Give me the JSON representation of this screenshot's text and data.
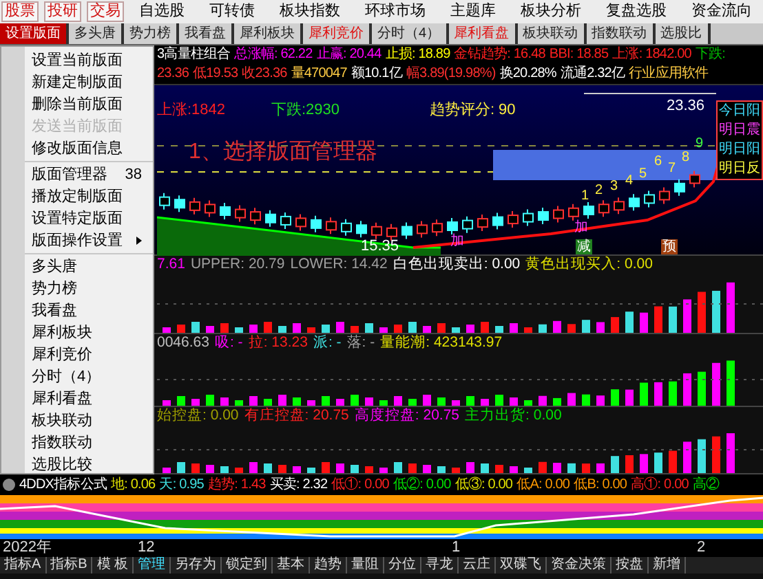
{
  "toolbar": [
    {
      "label": "股票",
      "kind": "boxed"
    },
    {
      "label": "投研",
      "kind": "boxed"
    },
    {
      "label": "交易",
      "kind": "boxed"
    },
    {
      "label": "自选股",
      "kind": "plain"
    },
    {
      "label": "可转债",
      "kind": "plain"
    },
    {
      "label": "板块指数",
      "kind": "plain"
    },
    {
      "label": "环球市场",
      "kind": "plain"
    },
    {
      "label": "主题库",
      "kind": "plain"
    },
    {
      "label": "板块分析",
      "kind": "plain"
    },
    {
      "label": "复盘选股",
      "kind": "plain"
    },
    {
      "label": "资金流向",
      "kind": "plain"
    }
  ],
  "tabs": [
    {
      "label": "设置版面",
      "selected": true,
      "highlighted": false
    },
    {
      "label": "多头唐",
      "selected": false,
      "highlighted": false
    },
    {
      "label": "势力榜",
      "selected": false,
      "highlighted": false
    },
    {
      "label": "我看盘",
      "selected": false,
      "highlighted": false
    },
    {
      "label": "犀利板块",
      "selected": false,
      "highlighted": false
    },
    {
      "label": "犀利竞价",
      "selected": false,
      "highlighted": true
    },
    {
      "label": "分时（4）",
      "selected": false,
      "highlighted": false
    },
    {
      "label": "犀利看盘",
      "selected": false,
      "highlighted": true
    },
    {
      "label": "板块联动",
      "selected": false,
      "highlighted": false
    },
    {
      "label": "指数联动",
      "selected": false,
      "highlighted": false
    },
    {
      "label": "选股比",
      "selected": false,
      "highlighted": false
    }
  ],
  "context_menu": {
    "groups": [
      [
        {
          "label": "设置当前版面",
          "disabled": false,
          "has_submenu": false
        },
        {
          "label": "新建定制版面",
          "disabled": false,
          "has_submenu": false
        },
        {
          "label": "删除当前版面",
          "disabled": false,
          "has_submenu": false
        },
        {
          "label": "发送当前版面",
          "disabled": true,
          "has_submenu": false
        },
        {
          "label": "修改版面信息",
          "disabled": false,
          "has_submenu": false
        }
      ],
      [
        {
          "label": "版面管理器",
          "shortcut": "38",
          "disabled": false,
          "has_submenu": false
        },
        {
          "label": "播放定制版面",
          "disabled": false,
          "has_submenu": false
        },
        {
          "label": "设置特定版面",
          "disabled": false,
          "has_submenu": false
        },
        {
          "label": "版面操作设置",
          "disabled": false,
          "has_submenu": true
        }
      ],
      [
        {
          "label": "多头唐",
          "disabled": false,
          "has_submenu": false
        },
        {
          "label": "势力榜",
          "disabled": false,
          "has_submenu": false
        },
        {
          "label": "我看盘",
          "disabled": false,
          "has_submenu": false
        },
        {
          "label": "犀利板块",
          "disabled": false,
          "has_submenu": false
        },
        {
          "label": "犀利竞价",
          "disabled": false,
          "has_submenu": false
        },
        {
          "label": "分时（4）",
          "disabled": false,
          "has_submenu": false
        },
        {
          "label": "犀利看盘",
          "disabled": false,
          "has_submenu": false
        },
        {
          "label": "板块联动",
          "disabled": false,
          "has_submenu": false
        },
        {
          "label": "指数联动",
          "disabled": false,
          "has_submenu": false
        },
        {
          "label": "选股比较",
          "disabled": false,
          "has_submenu": false
        }
      ]
    ]
  },
  "quote": {
    "line1": [
      {
        "text": "3高量柱组合",
        "color": "#ffffff"
      },
      {
        "text": "总涨幅: 62.22",
        "color": "#ff00ff"
      },
      {
        "text": "止赢: 20.44",
        "color": "#ff00ff"
      },
      {
        "text": "止损: 18.89",
        "color": "#ffff00"
      },
      {
        "text": "金钻趋势: 16.48",
        "color": "#ff2020"
      },
      {
        "text": "BBI: 18.85",
        "color": "#ff2020"
      },
      {
        "text": "上涨: 1842.00",
        "color": "#ff2020"
      },
      {
        "text": "下跌:",
        "color": "#00c000"
      }
    ],
    "line2": [
      {
        "text": "23.36",
        "color": "#ff3030"
      },
      {
        "text": "低19.53",
        "color": "#ff3030"
      },
      {
        "text": "收23.36",
        "color": "#ff3030"
      },
      {
        "text": "量470047",
        "color": "#ffcc44"
      },
      {
        "text": "额10.1亿",
        "color": "#ffffff"
      },
      {
        "text": "幅3.89(19.98%)",
        "color": "#ff3030"
      },
      {
        "text": "换20.28%",
        "color": "#ffffff"
      },
      {
        "text": "流通2.32亿",
        "color": "#ffffff"
      },
      {
        "text": "行业应用软件",
        "color": "#ffcc44"
      }
    ]
  },
  "main_chart": {
    "rise": "上涨:1842",
    "fall": "下跌:2930",
    "score_label": "趋势评分:",
    "score": "90",
    "high": "23.36",
    "low": "15.35",
    "annotation": "1、选择版面管理器",
    "wave_numbers": [
      "1",
      "2",
      "3",
      "4",
      "5",
      "6",
      "7",
      "8",
      "9"
    ],
    "markers": [
      {
        "text": "加",
        "kind": "add"
      },
      {
        "text": "加",
        "kind": "add"
      },
      {
        "text": "减",
        "kind": "reduce"
      },
      {
        "text": "预",
        "kind": "warn"
      }
    ],
    "side_labels": [
      {
        "text": "今日阳",
        "color": "#40e0ff"
      },
      {
        "text": "明日震",
        "color": "#ff40ff"
      },
      {
        "text": "明日阳",
        "color": "#40e0ff"
      },
      {
        "text": "明日反",
        "color": "#ffff40"
      }
    ]
  },
  "indicators": [
    {
      "values": [
        {
          "text": "7.61",
          "color": "#ff00ff"
        },
        {
          "text": "UPPER: 20.79",
          "color": "#a0a0a0"
        },
        {
          "text": "LOWER: 14.42",
          "color": "#a0a0a0"
        },
        {
          "text": "白色出现卖出: 0.00",
          "color": "#ffffff"
        },
        {
          "text": "黄色出现买入: 0.00",
          "color": "#e0e000"
        }
      ]
    },
    {
      "values": [
        {
          "text": "0046.63",
          "color": "#c0c0c0"
        },
        {
          "text": "吸: -",
          "color": "#ff00ff"
        },
        {
          "text": "拉: 13.23",
          "color": "#ff2020"
        },
        {
          "text": "派: -",
          "color": "#40e0e0"
        },
        {
          "text": "落: -",
          "color": "#a0a0a0"
        },
        {
          "text": "量能潮: 423143.97",
          "color": "#e0e000"
        }
      ]
    },
    {
      "values": [
        {
          "text": "始控盘: 0.00",
          "color": "#a0a000"
        },
        {
          "text": "有庄控盘: 20.75",
          "color": "#ff2020"
        },
        {
          "text": "高度控盘: 20.75",
          "color": "#ff00ff"
        },
        {
          "text": "主力出货: 0.00",
          "color": "#00e000"
        }
      ]
    }
  ],
  "ddx": {
    "name": "4DDX指标公式",
    "values": [
      {
        "text": "地: 0.06",
        "color": "#e0e000"
      },
      {
        "text": "天: 0.95",
        "color": "#40e0e0"
      },
      {
        "text": "趋势: 1.43",
        "color": "#ff2020"
      },
      {
        "text": "买卖: 2.32",
        "color": "#ffffff"
      },
      {
        "text": "低①: 0.00",
        "color": "#ff2020"
      },
      {
        "text": "低②: 0.00",
        "color": "#00e000"
      },
      {
        "text": "低③: 0.00",
        "color": "#e0e000"
      },
      {
        "text": "低A: 0.00",
        "color": "#ff9900"
      },
      {
        "text": "低B: 0.00",
        "color": "#ff9900"
      },
      {
        "text": "高①: 0.00",
        "color": "#ff2020"
      },
      {
        "text": "高②",
        "color": "#00e000"
      }
    ]
  },
  "date_axis": [
    "2022年",
    "12",
    "1",
    "2"
  ],
  "bottom_tabs": [
    {
      "label": "指标A",
      "selected": false
    },
    {
      "label": "指标B",
      "selected": false
    },
    {
      "label": "模 板",
      "selected": false
    },
    {
      "label": "管理",
      "selected": true
    },
    {
      "label": "另存为",
      "selected": false
    },
    {
      "label": "锁定到",
      "selected": false
    },
    {
      "label": "基本",
      "selected": false
    },
    {
      "label": "趋势",
      "selected": false
    },
    {
      "label": "量阻",
      "selected": false
    },
    {
      "label": "分位",
      "selected": false
    },
    {
      "label": "寻龙",
      "selected": false
    },
    {
      "label": "云庄",
      "selected": false
    },
    {
      "label": "双碟飞",
      "selected": false
    },
    {
      "label": "资金决策",
      "selected": false
    },
    {
      "label": "按盘",
      "selected": false
    },
    {
      "label": "新增",
      "selected": false
    }
  ]
}
